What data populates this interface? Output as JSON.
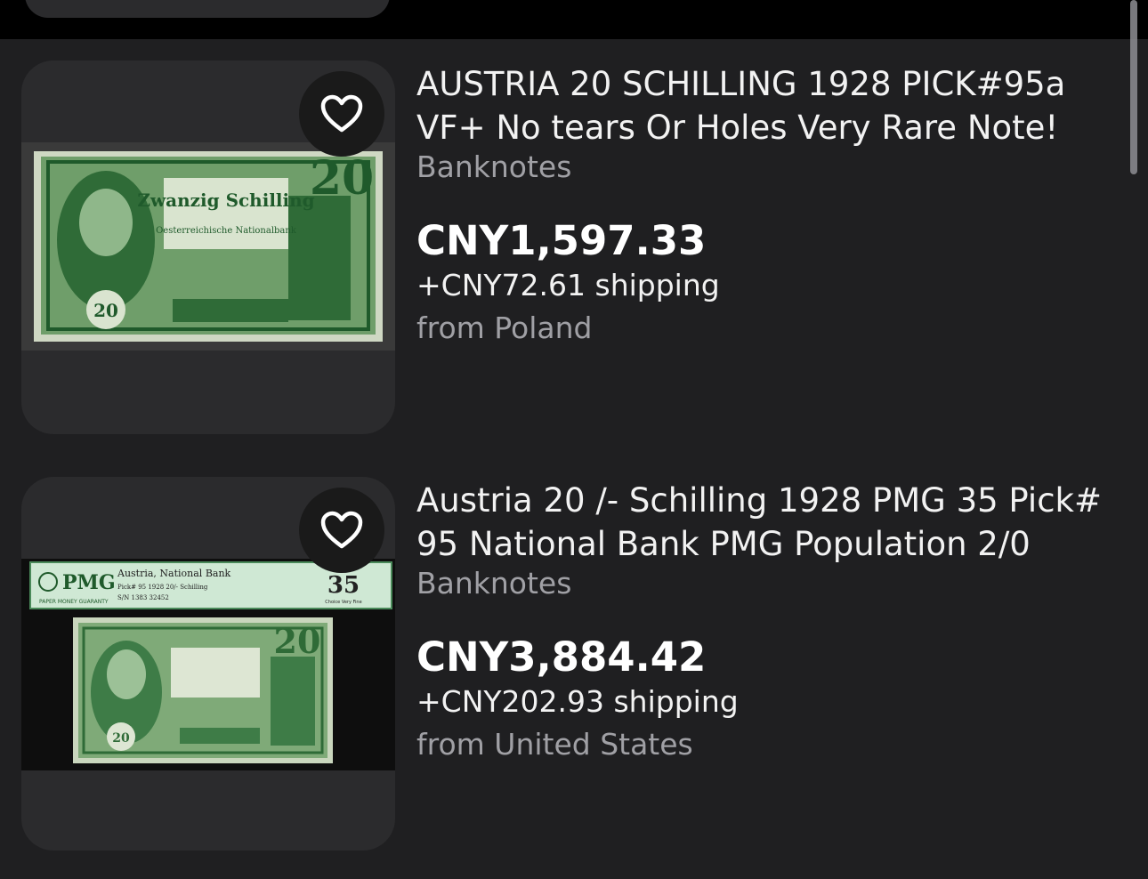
{
  "listings": [
    {
      "title": "AUSTRIA 20 SCHILLING 1928 PICK#95a VF+ No tears Or Holes Very Rare Note!",
      "category": "Banknotes",
      "price": "CNY1,597.33",
      "shipping": "+CNY72.61 shipping",
      "origin": "from Poland",
      "image": {
        "denomination": "20",
        "heading": "Zwanzig Schilling",
        "issuer": "Oesterreichische Nationalbank"
      }
    },
    {
      "title": "Austria 20 /- Schilling 1928 PMG 35 Pick# 95 National Bank PMG Population 2/0",
      "category": "Banknotes",
      "price": "CNY3,884.42",
      "shipping": "+CNY202.93 shipping",
      "origin": "from United States",
      "image": {
        "label_brand": "PMG",
        "label_brand_sub": "PAPER MONEY GUARANTY",
        "label_line1": "Austria, National Bank",
        "label_line2": "Pick# 95   1928   20/- Schilling",
        "label_line3": "S/N 1383 32452",
        "grade": "35",
        "grade_text": "Choice Very Fine",
        "denomination": "20"
      }
    }
  ],
  "icons": {
    "favorite": "heart-icon"
  },
  "colors": {
    "background": "#1f1f21",
    "card": "#2b2b2d",
    "note_green": "#2e7d3e",
    "muted_text": "#a0a0a5"
  }
}
